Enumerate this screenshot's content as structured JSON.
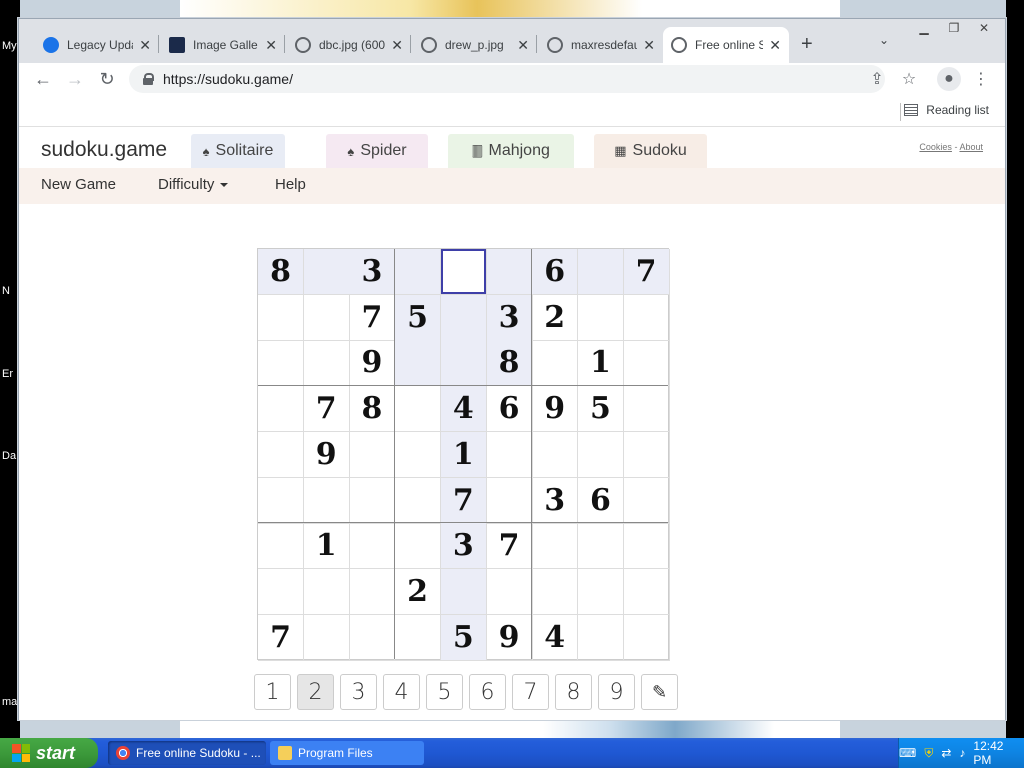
{
  "desktop": {
    "icon_labels": [
      "My",
      "N",
      "Er",
      "Da",
      "ma"
    ]
  },
  "browser": {
    "tabs": [
      {
        "title": "Legacy Upda",
        "favicon": "globe-blue-icon"
      },
      {
        "title": "Image Galle",
        "favicon": "image-gallery-icon"
      },
      {
        "title": "dbc.jpg (600",
        "favicon": "globe-icon"
      },
      {
        "title": "drew_p.jpg",
        "favicon": "globe-icon"
      },
      {
        "title": "maxresdefau",
        "favicon": "globe-icon"
      },
      {
        "title": "Free online S",
        "favicon": "globe-icon",
        "active": true
      }
    ],
    "url": "https://sudoku.game/",
    "reading_list_label": "Reading list"
  },
  "site": {
    "title": "sudoku.game",
    "game_tabs": [
      {
        "label": "Solitaire",
        "icon": "spade-icon",
        "color": "#e8ecf5"
      },
      {
        "label": "Spider",
        "icon": "spade-icon",
        "color": "#f5e9f2"
      },
      {
        "label": "Mahjong",
        "icon": "mahjong-icon",
        "color": "#eaf4e6"
      },
      {
        "label": "Sudoku",
        "icon": "grid-icon",
        "color": "#f7ede6"
      }
    ],
    "cookies_label": "Cookies",
    "about_label": "About",
    "links_separator": "-",
    "menu": {
      "new_game": "New Game",
      "difficulty": "Difficulty",
      "help": "Help"
    }
  },
  "sudoku": {
    "grid": [
      [
        "8",
        "",
        "3",
        "",
        "",
        "",
        "6",
        "",
        "7"
      ],
      [
        "",
        "",
        "7",
        "5",
        "",
        "3",
        "2",
        "",
        ""
      ],
      [
        "",
        "",
        "9",
        "",
        "",
        "8",
        "",
        "1",
        ""
      ],
      [
        "",
        "7",
        "8",
        "",
        "4",
        "6",
        "9",
        "5",
        ""
      ],
      [
        "",
        "9",
        "",
        "",
        "1",
        "",
        "",
        "",
        ""
      ],
      [
        "",
        "",
        "",
        "",
        "7",
        "",
        "3",
        "6",
        ""
      ],
      [
        "",
        "1",
        "",
        "",
        "3",
        "7",
        "",
        "",
        ""
      ],
      [
        "",
        "",
        "",
        "2",
        "",
        "",
        "",
        "",
        ""
      ],
      [
        "7",
        "",
        "",
        "",
        "5",
        "9",
        "4",
        "",
        ""
      ]
    ],
    "selected_cell": {
      "row": 1,
      "col": 5
    },
    "selection_color": "#3e3fa8",
    "shade_color": "#ebedf7",
    "numpad": [
      "1",
      "2",
      "3",
      "4",
      "5",
      "6",
      "7",
      "8",
      "9"
    ],
    "numpad_hovered": "2",
    "notes_button_icon": "pencil-edit-icon"
  },
  "taskbar": {
    "start_label": "start",
    "tasks": [
      {
        "label": "Free online Sudoku - ...",
        "icon": "chrome-icon",
        "active": true
      },
      {
        "label": "Program Files",
        "icon": "folder-icon",
        "active": false
      }
    ],
    "clock": "12:42 PM"
  }
}
